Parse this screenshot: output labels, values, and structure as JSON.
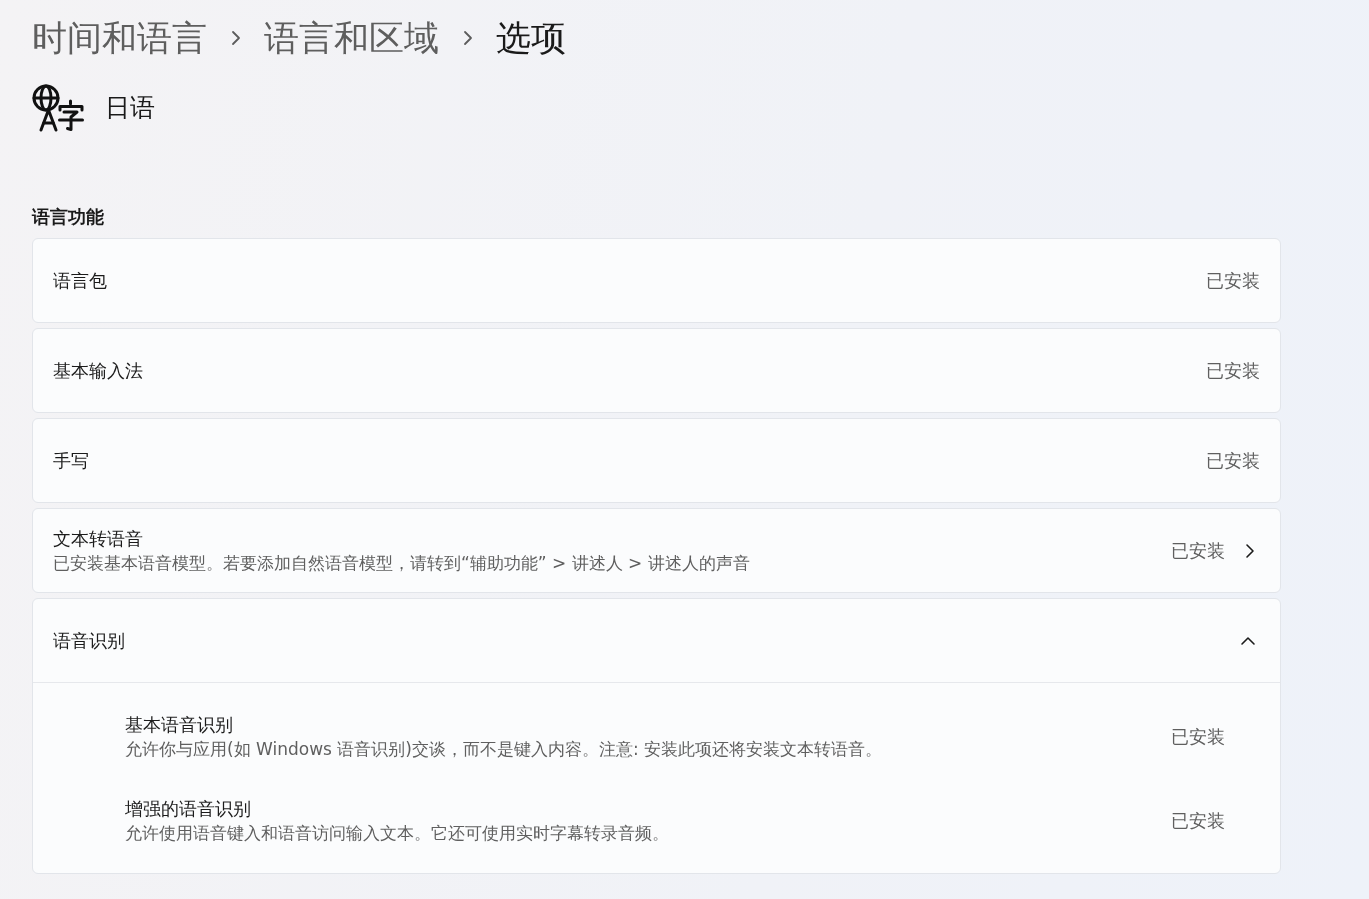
{
  "breadcrumb": [
    {
      "label": "时间和语言",
      "current": false
    },
    {
      "label": "语言和区域",
      "current": false
    },
    {
      "label": "选项",
      "current": true
    }
  ],
  "language": {
    "name": "日语"
  },
  "section": {
    "title": "语言功能",
    "features": [
      {
        "kind": "plain",
        "title": "语言包",
        "status": "已安装"
      },
      {
        "kind": "plain",
        "title": "基本输入法",
        "status": "已安装"
      },
      {
        "kind": "plain",
        "title": "手写",
        "status": "已安装"
      },
      {
        "kind": "link",
        "title": "文本转语音",
        "description": "已安装基本语音模型。若要添加自然语音模型，请转到“辅助功能” > 讲述人 > 讲述人的声音",
        "status": "已安装"
      },
      {
        "kind": "expander",
        "title": "语音识别",
        "expanded": true,
        "children": [
          {
            "title": "基本语音识别",
            "description": "允许你与应用(如 Windows 语音识别)交谈，而不是键入内容。注意: 安装此项还将安装文本转语音。",
            "status": "已安装"
          },
          {
            "title": "增强的语音识别",
            "description": "允许使用语音键入和语音访问输入文本。它还可使用实时字幕转录音频。",
            "status": "已安装"
          }
        ]
      }
    ]
  }
}
